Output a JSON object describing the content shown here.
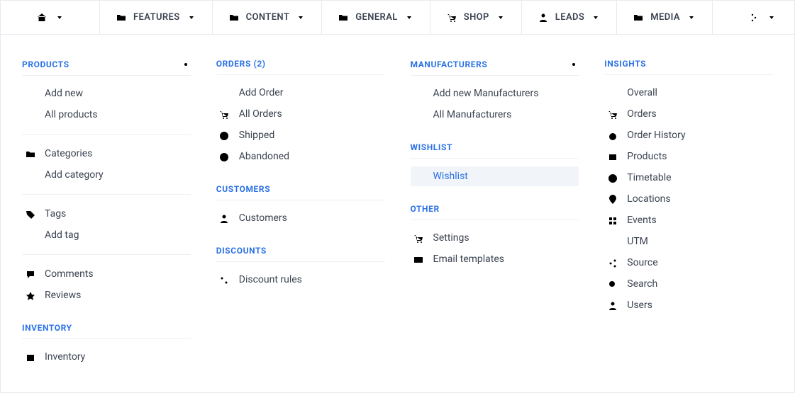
{
  "topnav": {
    "home": {
      "icon": "home"
    },
    "features": {
      "label": "FEATURES",
      "icon": "folder"
    },
    "content": {
      "label": "CONTENT",
      "icon": "folder"
    },
    "general": {
      "label": "GENERAL",
      "icon": "folder"
    },
    "shop": {
      "label": "SHOP",
      "icon": "cart"
    },
    "leads": {
      "label": "LEADS",
      "icon": "user"
    },
    "media": {
      "label": "MEDIA",
      "icon": "folder"
    }
  },
  "col1": {
    "products_title": "PRODUCTS",
    "add_new": "Add new",
    "all_products": "All products",
    "categories": "Categories",
    "add_category": "Add category",
    "tags": "Tags",
    "add_tag": "Add tag",
    "comments": "Comments",
    "reviews": "Reviews",
    "inventory_title": "INVENTORY",
    "inventory": "Inventory"
  },
  "col2": {
    "orders_title": "ORDERS (2)",
    "add_order": "Add Order",
    "all_orders": "All Orders",
    "shipped": "Shipped",
    "abandoned": "Abandoned",
    "customers_title": "CUSTOMERS",
    "customers": "Customers",
    "discounts_title": "DISCOUNTS",
    "discount_rules": "Discount rules"
  },
  "col3": {
    "manufacturers_title": "MANUFACTURERS",
    "add_manufacturers": "Add new Manufacturers",
    "all_manufacturers": "All Manufacturers",
    "wishlist_title": "WISHLIST",
    "wishlist": "Wishlist",
    "other_title": "OTHER",
    "settings": "Settings",
    "email_templates": "Email templates"
  },
  "col4": {
    "insights_title": "INSIGHTS",
    "overall": "Overall",
    "orders": "Orders",
    "order_history": "Order History",
    "products": "Products",
    "timetable": "Timetable",
    "locations": "Locations",
    "events": "Events",
    "utm": "UTM",
    "source": "Source",
    "search": "Search",
    "users": "Users"
  }
}
